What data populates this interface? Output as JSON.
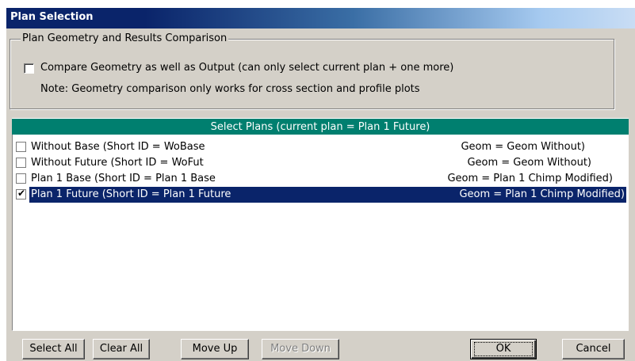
{
  "window": {
    "title": "Plan Selection"
  },
  "comparison_group": {
    "legend": "Plan Geometry and Results Comparison",
    "compare_checkbox_checked": false,
    "compare_label": "Compare Geometry as well as Output (can only select current plan + one more)",
    "note": "Note: Geometry comparison only works for cross section and profile plots"
  },
  "plans": {
    "header": "Select Plans  (current plan = Plan 1 Future)",
    "items": [
      {
        "name": "Without Base  (Short ID = WoBase",
        "geom": "Geom = Geom Without)",
        "checked": false,
        "selected": false
      },
      {
        "name": "Without Future  (Short ID = WoFut",
        "geom": "Geom = Geom Without)",
        "checked": false,
        "selected": false
      },
      {
        "name": "Plan 1 Base  (Short ID = Plan 1 Base",
        "geom": "Geom = Plan 1 Chimp Modified)",
        "checked": false,
        "selected": false
      },
      {
        "name": "Plan 1 Future  (Short ID = Plan 1 Future",
        "geom": "Geom = Plan 1 Chimp Modified)",
        "checked": true,
        "selected": true
      }
    ]
  },
  "buttons": {
    "select_all": "Select All",
    "clear_all": "Clear All",
    "move_up": "Move Up",
    "move_down": "Move Down",
    "move_down_enabled": false,
    "ok": "OK",
    "cancel": "Cancel"
  },
  "colors": {
    "title_bar": "#0a246a",
    "list_header": "#007f6f",
    "selection": "#0a246a",
    "dialog_face": "#d4d0c8"
  },
  "icons": {
    "checkbox_checked": "check-mark-icon",
    "checkbox_unchecked": "empty-checkbox-icon"
  }
}
